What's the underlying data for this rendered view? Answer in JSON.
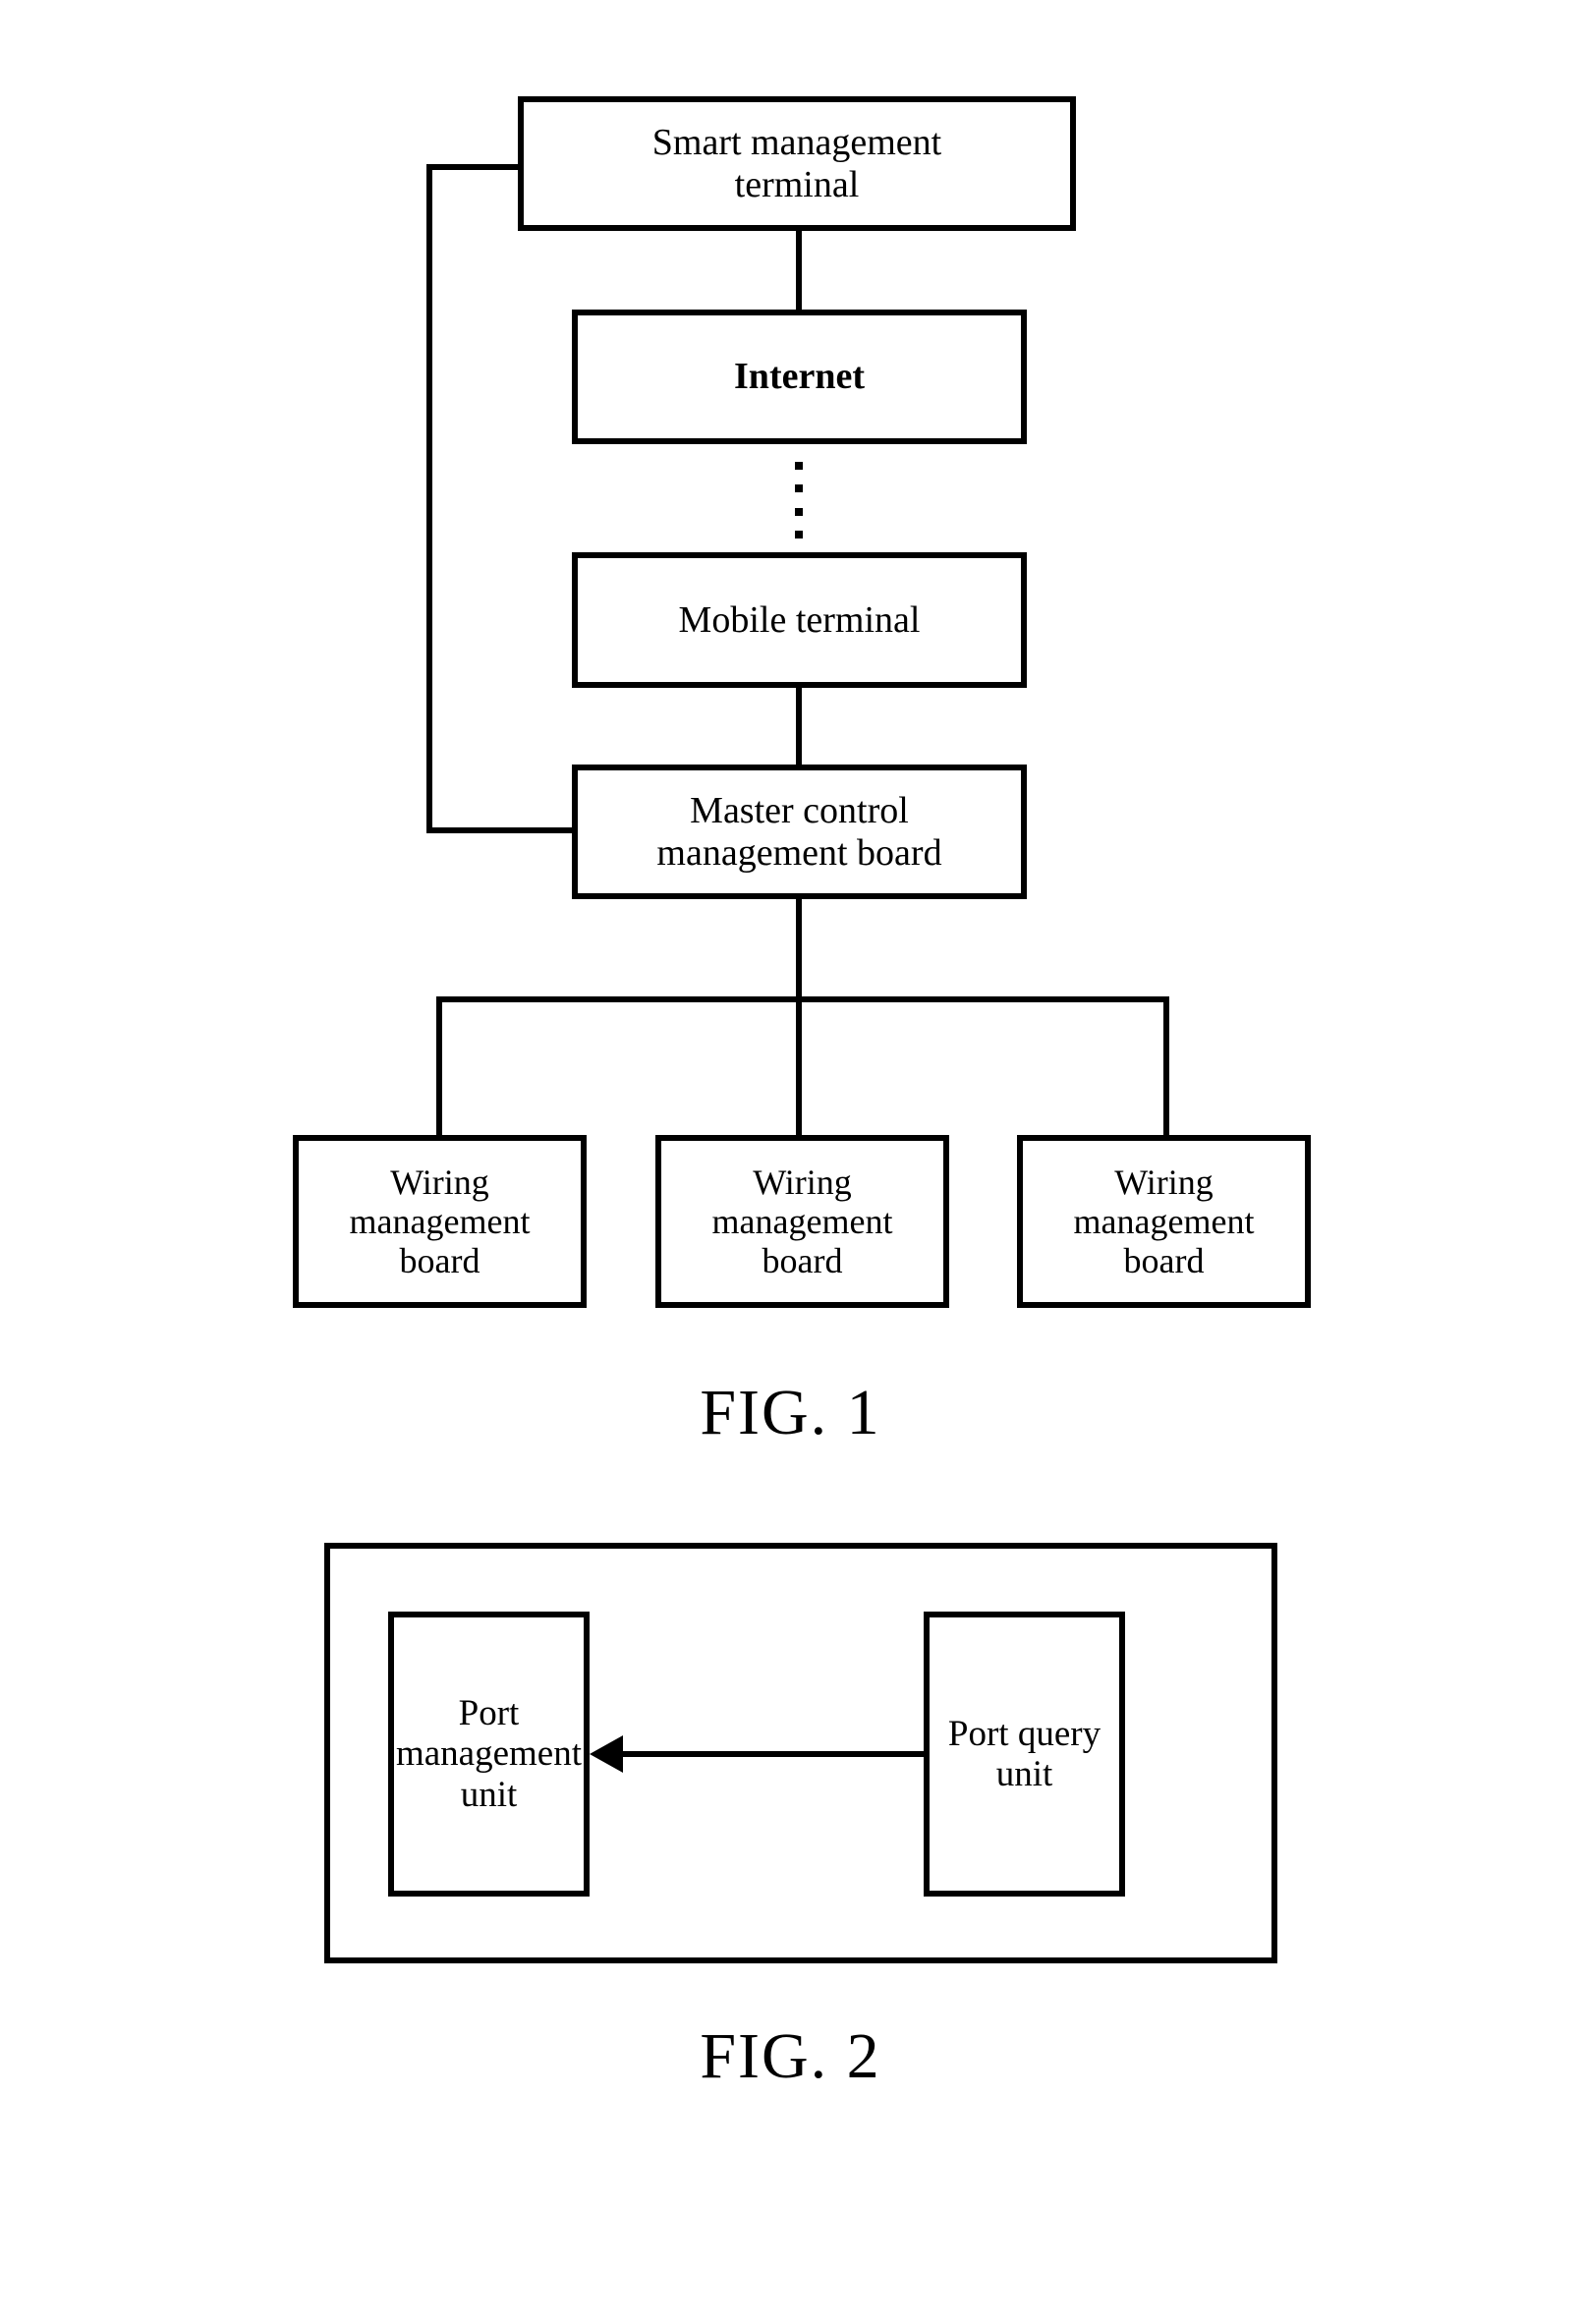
{
  "figures": [
    {
      "caption": "FIG. 1",
      "nodes": {
        "smart_terminal": "Smart management\nterminal",
        "internet": "Internet",
        "mobile_terminal": "Mobile terminal",
        "master_control": "Master control\nmanagement board",
        "wiring_boards": [
          "Wiring\nmanagement\nboard",
          "Wiring\nmanagement\nboard",
          "Wiring\nmanagement\nboard"
        ]
      }
    },
    {
      "caption": "FIG. 2",
      "nodes": {
        "port_management": "Port\nmanagement\nunit",
        "port_query": "Port query\nunit"
      }
    }
  ],
  "style": {
    "line_color": "#000000",
    "background": "#ffffff"
  }
}
